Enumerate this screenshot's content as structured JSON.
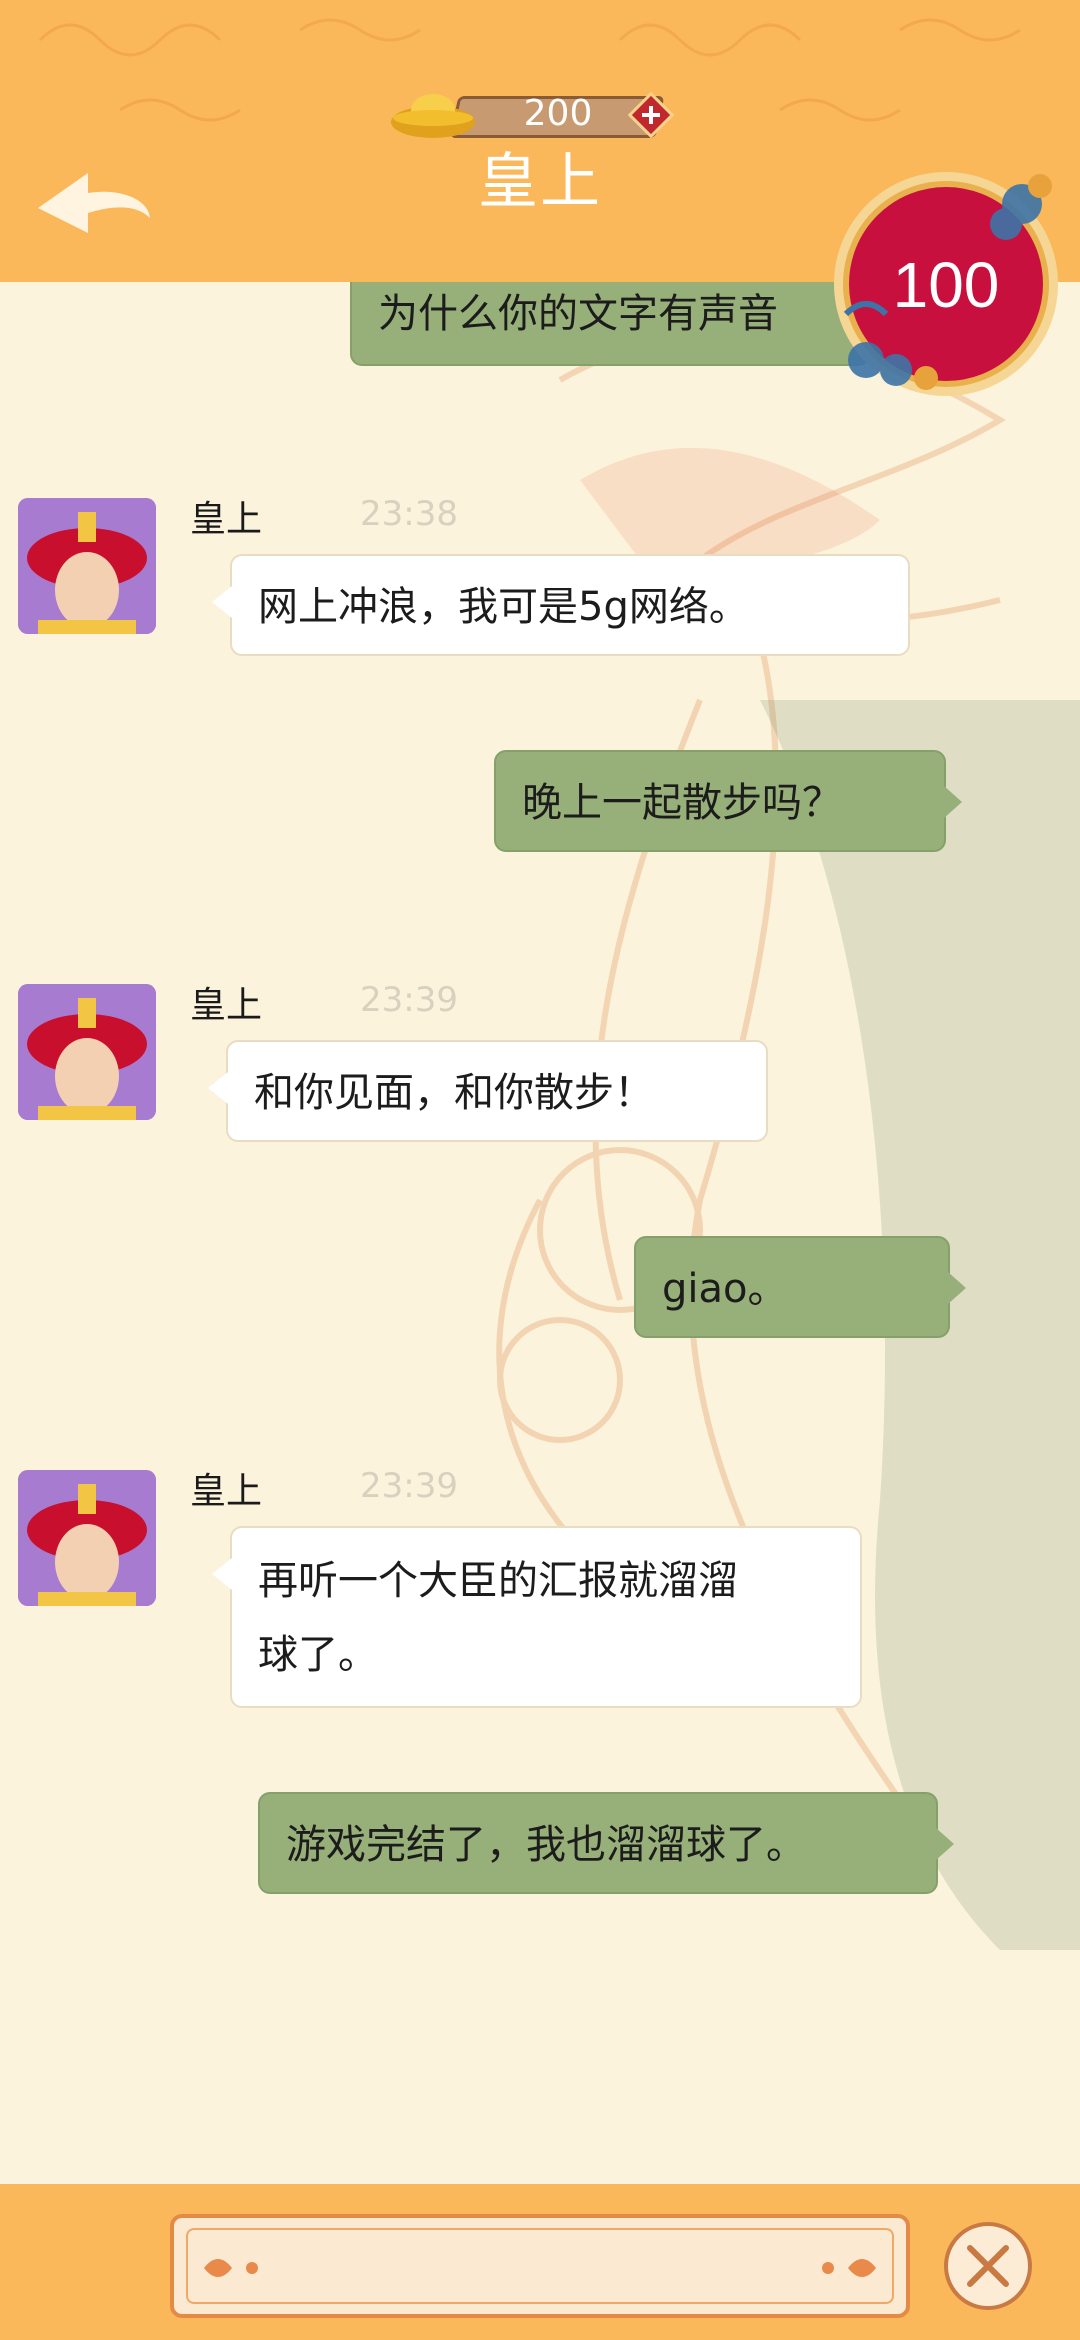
{
  "header": {
    "title": "皇上",
    "coins": "200",
    "score": "100"
  },
  "messages": [
    {
      "side": "me",
      "text": "为什么你的文字有声音"
    },
    {
      "side": "them",
      "sender": "皇上",
      "time": "23:38",
      "text": "网上冲浪，我可是5g网络。"
    },
    {
      "side": "me",
      "text": "晚上一起散步吗？"
    },
    {
      "side": "them",
      "sender": "皇上",
      "time": "23:39",
      "text": "和你见面，和你散步！"
    },
    {
      "side": "me",
      "text": "giao。"
    },
    {
      "side": "them",
      "sender": "皇上",
      "time": "23:39",
      "text_line1": "再听一个大臣的汇报就溜溜",
      "text_line2": "球了。"
    },
    {
      "side": "me",
      "text": "游戏完结了，我也溜溜球了。"
    }
  ],
  "input": {
    "placeholder": ""
  },
  "colors": {
    "header": "#fbb85a",
    "background": "#fcf3dc",
    "my_bubble": "#97af78",
    "their_bubble": "#ffffff",
    "score_badge": "#c8103e"
  },
  "icons": [
    "back-arrow-icon",
    "gold-ingot-icon",
    "plus-icon",
    "score-badge-icon",
    "close-icon"
  ]
}
